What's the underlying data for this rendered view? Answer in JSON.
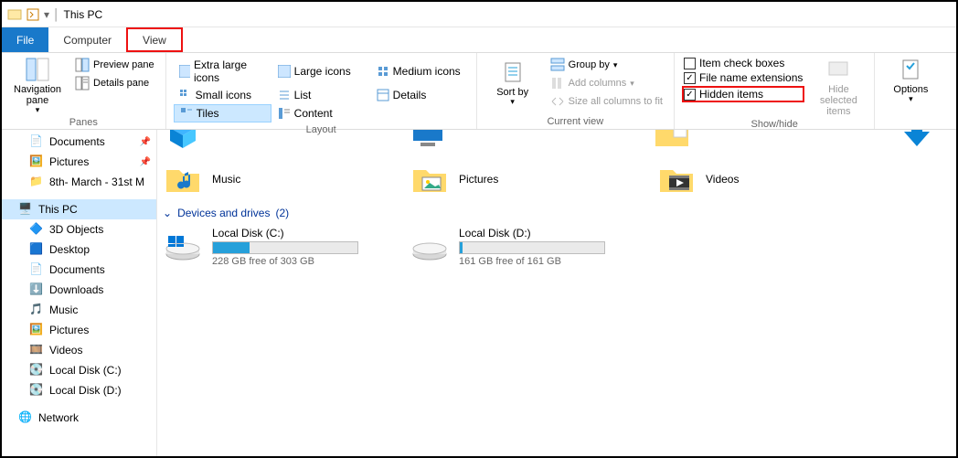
{
  "window": {
    "title": "This PC"
  },
  "tabs": {
    "file": "File",
    "computer": "Computer",
    "view": "View"
  },
  "ribbon": {
    "panes": {
      "label": "Panes",
      "nav": "Navigation pane",
      "preview": "Preview pane",
      "details": "Details pane"
    },
    "layout": {
      "label": "Layout",
      "xlarge": "Extra large icons",
      "large": "Large icons",
      "medium": "Medium icons",
      "small": "Small icons",
      "list": "List",
      "details": "Details",
      "tiles": "Tiles",
      "content": "Content"
    },
    "currentview": {
      "label": "Current view",
      "sort": "Sort by",
      "group": "Group by",
      "addcols": "Add columns",
      "fit": "Size all columns to fit"
    },
    "showhide": {
      "label": "Show/hide",
      "checkboxes": "Item check boxes",
      "ext": "File name extensions",
      "hidden": "Hidden items",
      "hidesel": "Hide selected items"
    },
    "options": "Options"
  },
  "sidebar": {
    "items": [
      {
        "label": "Documents",
        "icon": "doc",
        "pin": true
      },
      {
        "label": "Pictures",
        "icon": "pic",
        "pin": true
      },
      {
        "label": "8th- March - 31st M",
        "icon": "folder"
      }
    ],
    "thispc": {
      "label": "This PC",
      "selected": true
    },
    "pcchildren": [
      {
        "label": "3D Objects",
        "icon": "3d"
      },
      {
        "label": "Desktop",
        "icon": "desktop"
      },
      {
        "label": "Documents",
        "icon": "doc"
      },
      {
        "label": "Downloads",
        "icon": "down"
      },
      {
        "label": "Music",
        "icon": "music"
      },
      {
        "label": "Pictures",
        "icon": "pic"
      },
      {
        "label": "Videos",
        "icon": "video"
      },
      {
        "label": "Local Disk (C:)",
        "icon": "disk"
      },
      {
        "label": "Local Disk (D:)",
        "icon": "disk"
      }
    ],
    "network": {
      "label": "Network"
    }
  },
  "main": {
    "folders": [
      {
        "label": "Music"
      },
      {
        "label": "Pictures"
      },
      {
        "label": "Videos"
      }
    ],
    "section": {
      "label": "Devices and drives",
      "count": "(2)"
    },
    "drives": [
      {
        "name": "Local Disk (C:)",
        "sub": "228 GB free of 303 GB",
        "fill": 25
      },
      {
        "name": "Local Disk (D:)",
        "sub": "161 GB free of 161 GB",
        "fill": 2
      }
    ]
  }
}
